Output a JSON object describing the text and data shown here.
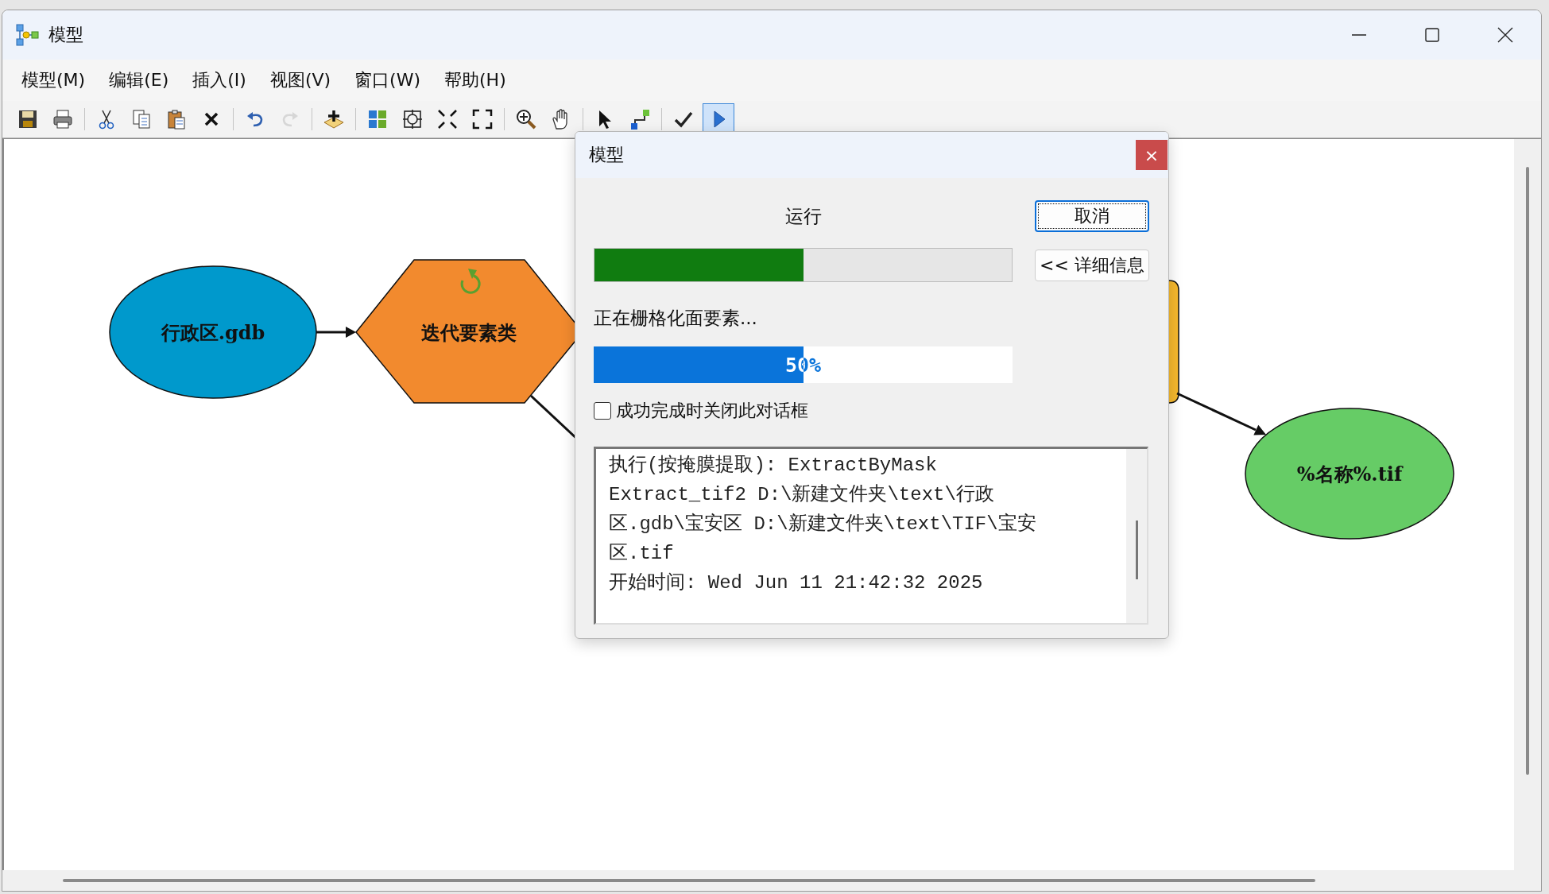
{
  "window": {
    "title": "模型"
  },
  "menu": [
    "模型(M)",
    "编辑(E)",
    "插入(I)",
    "视图(V)",
    "窗口(W)",
    "帮助(H)"
  ],
  "toolbar": [
    [
      {
        "kind": "save",
        "disabled": false,
        "pressed": false
      },
      {
        "kind": "print",
        "disabled": false,
        "pressed": false
      }
    ],
    [
      {
        "kind": "cut",
        "disabled": false,
        "pressed": false
      },
      {
        "kind": "copy",
        "disabled": false,
        "pressed": false
      },
      {
        "kind": "paste",
        "disabled": false,
        "pressed": false
      },
      {
        "kind": "delete",
        "disabled": false,
        "pressed": false
      }
    ],
    [
      {
        "kind": "undo",
        "disabled": false,
        "pressed": false
      },
      {
        "kind": "redo",
        "disabled": true,
        "pressed": false
      }
    ],
    [
      {
        "kind": "add",
        "disabled": false,
        "pressed": false
      }
    ],
    [
      {
        "kind": "layout",
        "disabled": false,
        "pressed": false
      },
      {
        "kind": "fit",
        "disabled": false,
        "pressed": false
      },
      {
        "kind": "shrink",
        "disabled": false,
        "pressed": false
      },
      {
        "kind": "expand",
        "disabled": false,
        "pressed": false
      }
    ],
    [
      {
        "kind": "zoom",
        "disabled": false,
        "pressed": false
      },
      {
        "kind": "pan",
        "disabled": false,
        "pressed": false
      }
    ],
    [
      {
        "kind": "select",
        "disabled": false,
        "pressed": false
      },
      {
        "kind": "connect",
        "disabled": false,
        "pressed": false
      }
    ],
    [
      {
        "kind": "validate",
        "disabled": false,
        "pressed": false
      },
      {
        "kind": "run",
        "disabled": false,
        "pressed": true
      }
    ]
  ],
  "diagram": {
    "nodes": [
      {
        "kind": "data",
        "label": "行政区.gdb",
        "color": "#0099cc"
      },
      {
        "kind": "iterator",
        "label": "迭代要素类",
        "color": "#f28a2e"
      },
      {
        "kind": "tool",
        "color": "#f5b82e"
      },
      {
        "kind": "data",
        "label": "%名称%.tif",
        "color": "#66cc66"
      }
    ]
  },
  "dialog": {
    "title": "模型",
    "close": "×",
    "status": "运行",
    "buttons": [
      {
        "label": "取消",
        "focused": true
      },
      {
        "label": "<< 详细信息",
        "focused": false
      }
    ],
    "progress": {
      "level": 0.5
    },
    "message": "正在栅格化面要素...",
    "sub_progress": {
      "level": 0.5,
      "label": "50%"
    },
    "close_on_success": {
      "label": "成功完成时关闭此对话框",
      "checked": false
    },
    "log": [
      "执行(按掩膜提取): ExtractByMask",
      "Extract_tif2 D:\\新建文件夹\\text\\行政",
      "区.gdb\\宝安区 D:\\新建文件夹\\text\\TIF\\宝安",
      "区.tif",
      "开始时间: Wed Jun 11 21:42:32 2025"
    ]
  }
}
